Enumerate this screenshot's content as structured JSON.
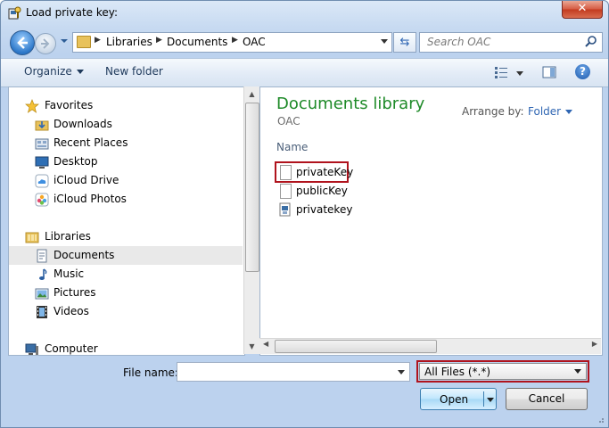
{
  "window": {
    "title": "Load private key:",
    "close_glyph": "✕"
  },
  "address": {
    "crumbs": [
      "Libraries",
      "Documents",
      "OAC"
    ]
  },
  "search": {
    "placeholder": "Search OAC"
  },
  "toolbar": {
    "organize_label": "Organize",
    "new_folder_label": "New folder",
    "help_glyph": "?"
  },
  "nav": {
    "favorites_label": "Favorites",
    "favorites": [
      "Downloads",
      "Recent Places",
      "Desktop",
      "iCloud Drive",
      "iCloud Photos"
    ],
    "libraries_label": "Libraries",
    "libraries": [
      "Documents",
      "Music",
      "Pictures",
      "Videos"
    ],
    "computer_label": "Computer",
    "selected": "Documents"
  },
  "content": {
    "library_title": "Documents library",
    "library_subtitle": "OAC",
    "arrange_by_label": "Arrange by:",
    "arrange_by_value": "Folder",
    "column_name": "Name",
    "files": [
      {
        "name": "privateKey",
        "icon": "blank-file-icon",
        "highlighted": true
      },
      {
        "name": "publicKey",
        "icon": "blank-file-icon",
        "highlighted": false
      },
      {
        "name": "privatekey",
        "icon": "putty-key-file-icon",
        "highlighted": false
      }
    ]
  },
  "footer": {
    "file_name_label": "File name:",
    "file_name_value": "",
    "file_type_value": "All Files (*.*)",
    "open_label": "Open",
    "cancel_label": "Cancel"
  },
  "colors": {
    "highlight_border": "#b0131d",
    "library_title": "#1e8a28"
  }
}
